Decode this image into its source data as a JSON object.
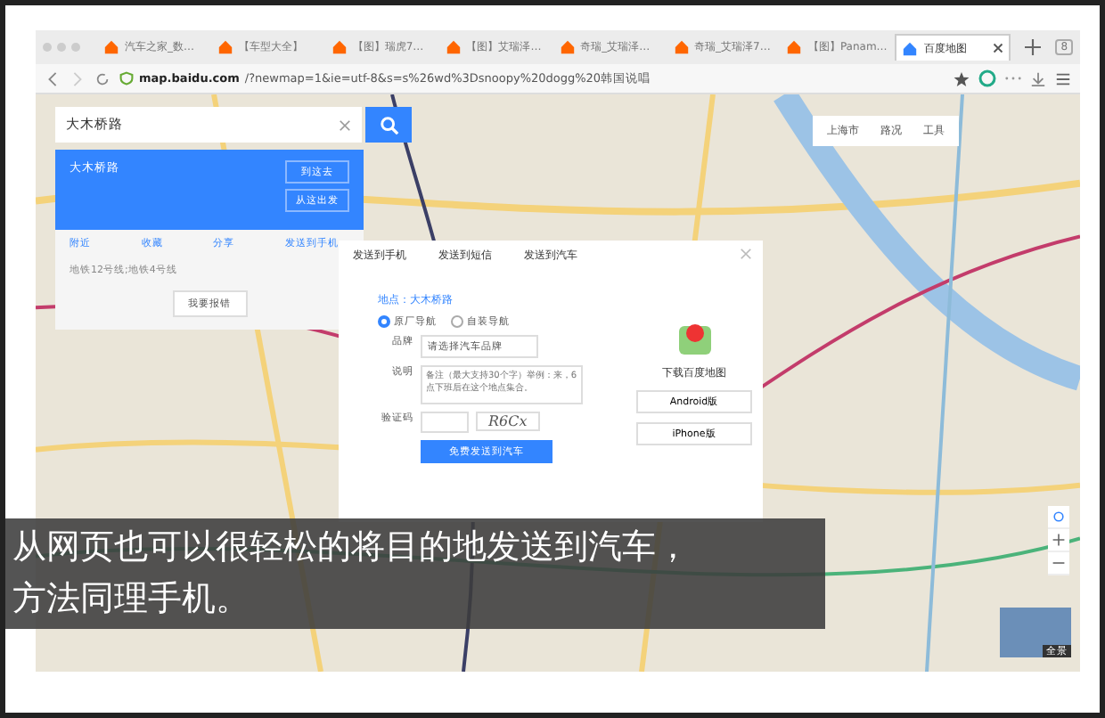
{
  "browser": {
    "tabs": [
      {
        "label": "汽车之家_数…",
        "selected": false
      },
      {
        "label": "【车型大全】",
        "selected": false
      },
      {
        "label": "【图】瑞虎7…",
        "selected": false
      },
      {
        "label": "【图】艾瑞泽…",
        "selected": false
      },
      {
        "label": "奇瑞_艾瑞泽…",
        "selected": false
      },
      {
        "label": "奇瑞_艾瑞泽7…",
        "selected": false
      },
      {
        "label": "【图】Panam…",
        "selected": false
      },
      {
        "label": "百度地图",
        "selected": true
      }
    ],
    "tab_count": "8",
    "url_host": "map.baidu.com",
    "url_rest": "/?newmap=1&ie=utf-8&s=s%26wd%3Dsnoopy%20dogg%20韩国说唱"
  },
  "search": {
    "value": "大木桥路"
  },
  "place_card": {
    "title": "大木桥路",
    "route_buttons": [
      "到这去",
      "从这出发"
    ],
    "actions": [
      "附近",
      "收藏",
      "分享",
      "发送到手机"
    ],
    "address": "地铁12号线;地铁4号线",
    "report": "我要报错"
  },
  "map_toolbar": [
    "上海市",
    "路况",
    "工具"
  ],
  "dialog": {
    "tabs": [
      "发送到手机",
      "发送到短信",
      "发送到汽车"
    ],
    "place": "地点：大木桥路",
    "nav_options": [
      {
        "label": "原厂导航",
        "selected": true
      },
      {
        "label": "自装导航",
        "selected": false
      }
    ],
    "brand_label": "品牌",
    "brand_value": "请选择汽车品牌",
    "note_label": "说明",
    "note_placeholder": "备注（最大支持30个字）举例：来，6点下班后在这个地点集合。",
    "captcha_label": "验证码",
    "captcha_text": "R6Cx",
    "submit": "免费发送到汽车",
    "download_title": "下载百度地图",
    "download_buttons": [
      "Android版",
      "iPhone版"
    ]
  },
  "street_view_label": "全景",
  "caption": [
    "从网页也可以很轻松的将目的地发送到汽车，",
    "方法同理手机。"
  ]
}
